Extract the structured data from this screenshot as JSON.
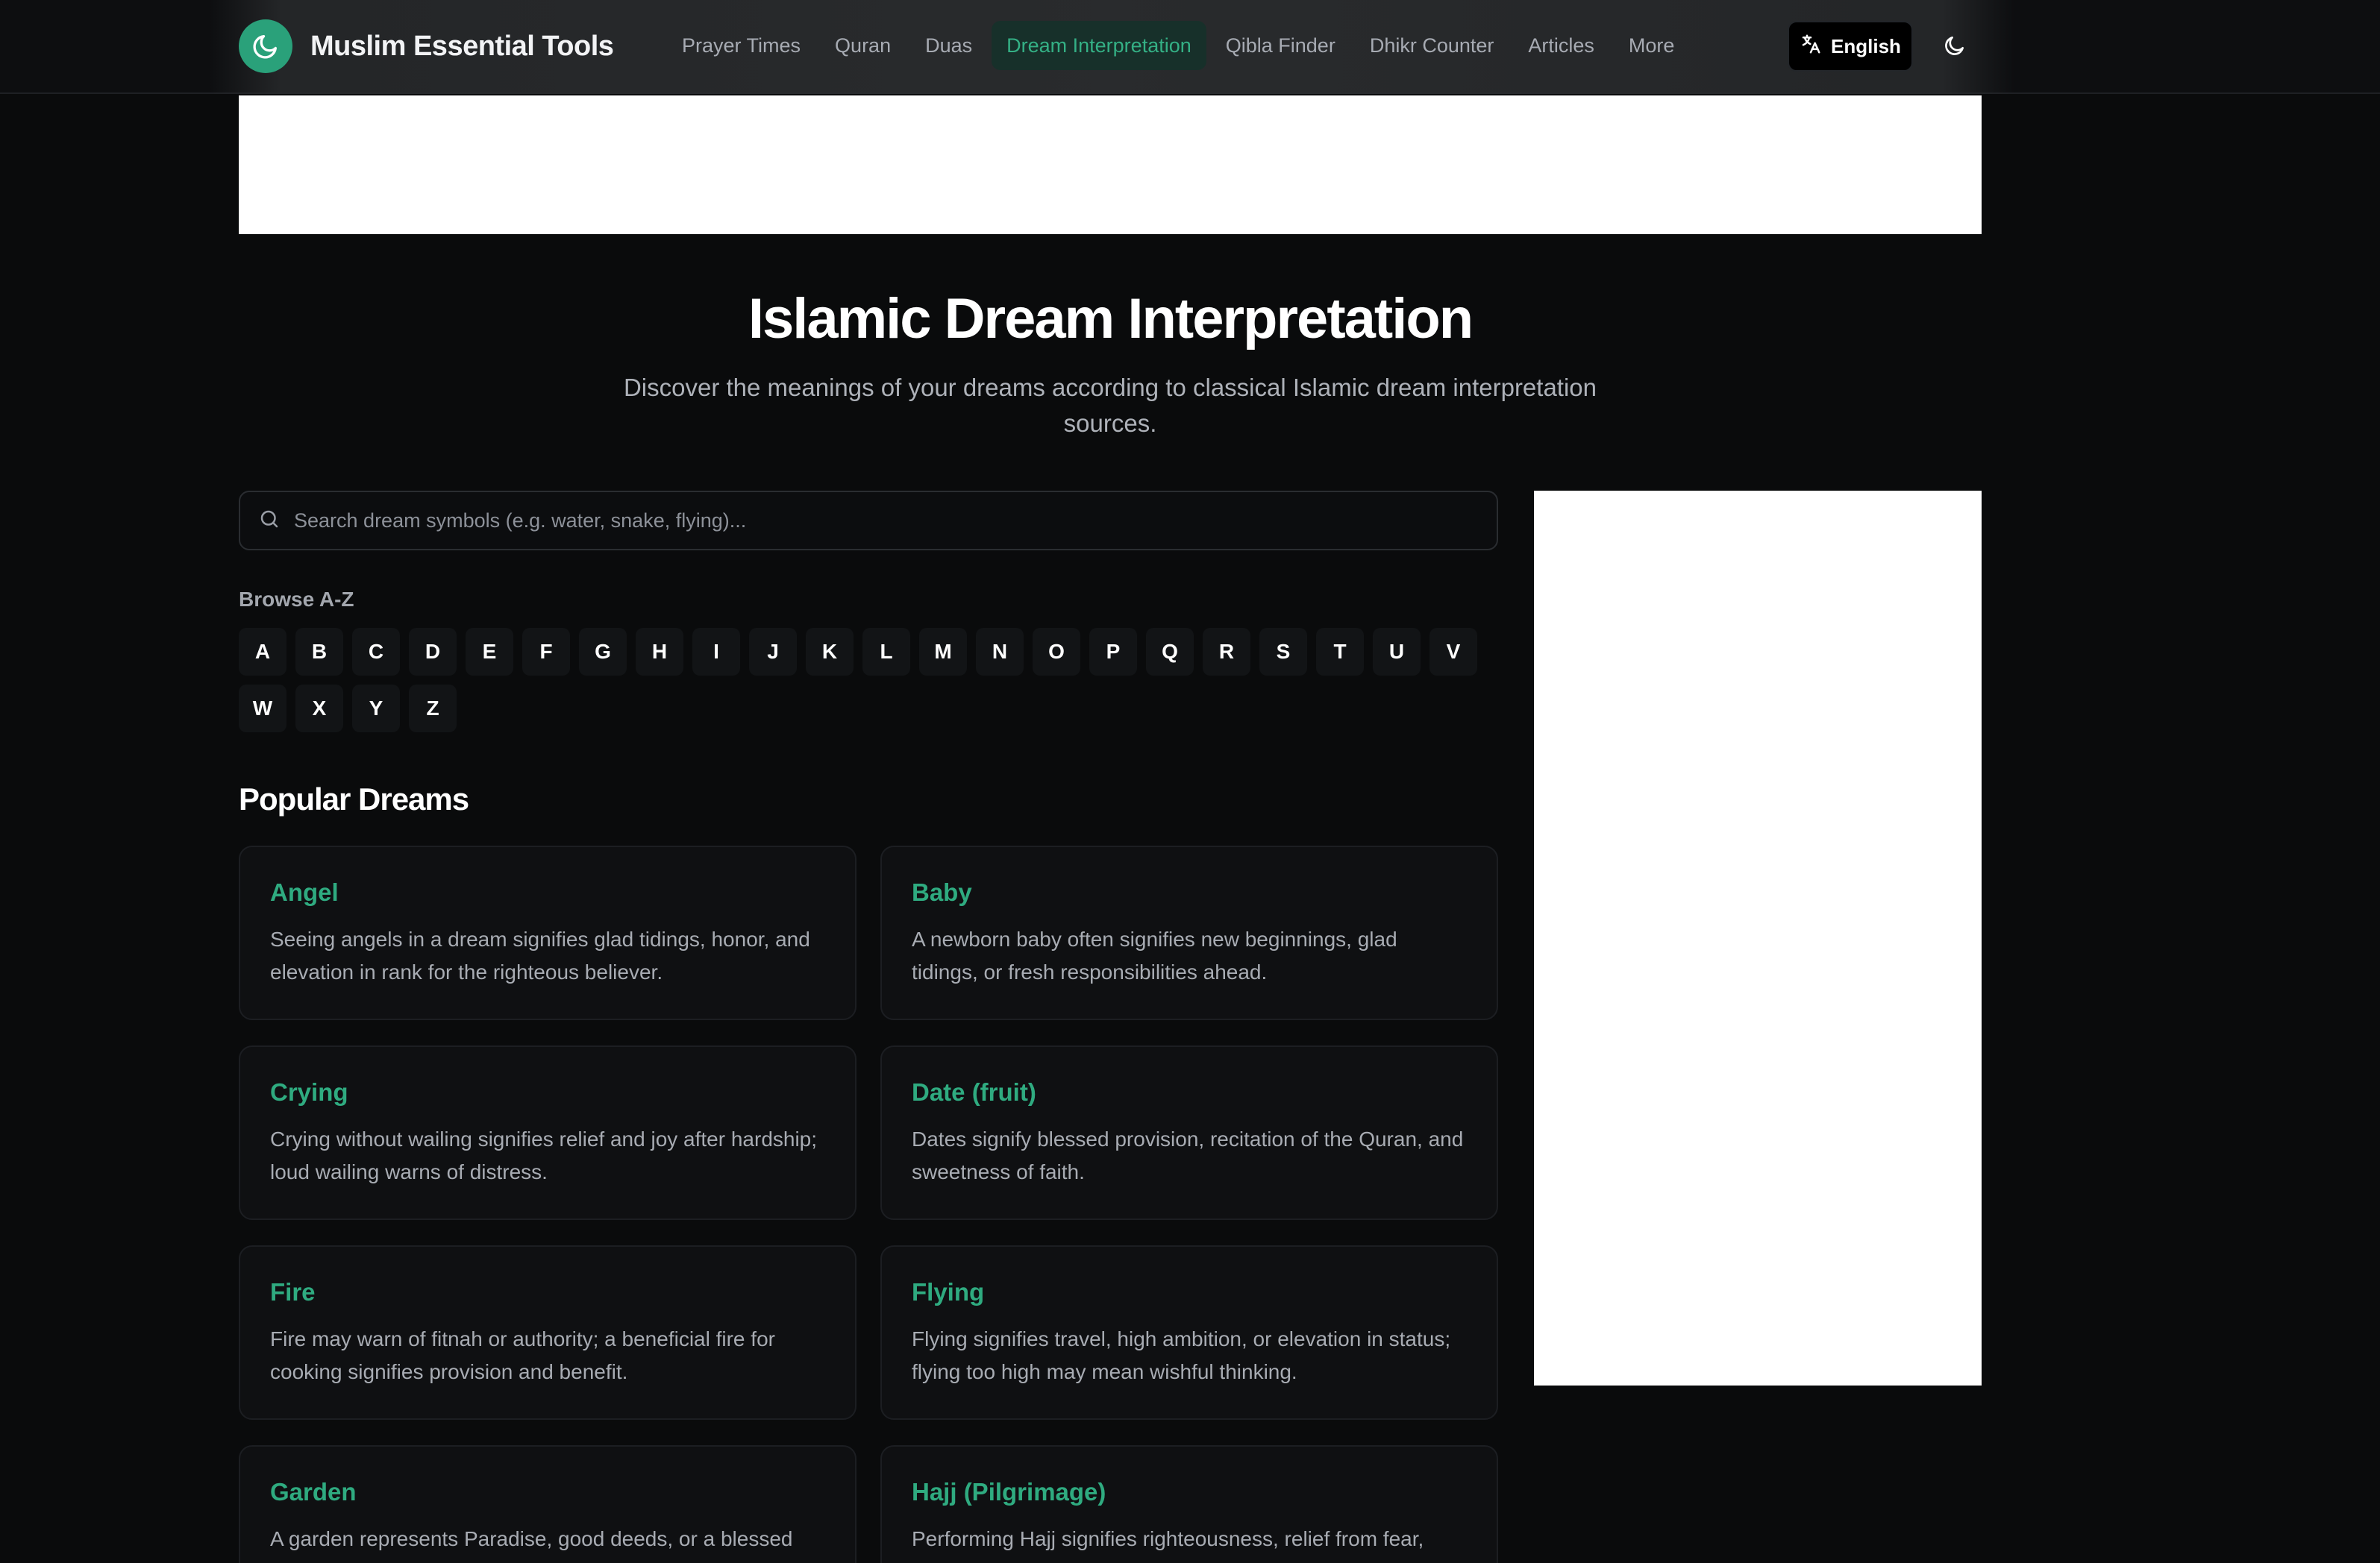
{
  "brand": {
    "name": "Muslim Essential Tools",
    "logo_icon": "crescent-moon-icon",
    "accent": "#2aa17a"
  },
  "nav": {
    "items": [
      {
        "label": "Prayer Times"
      },
      {
        "label": "Quran"
      },
      {
        "label": "Duas"
      },
      {
        "label": "Dream Interpretation"
      },
      {
        "label": "Qibla Finder"
      },
      {
        "label": "Dhikr Counter"
      },
      {
        "label": "Articles"
      },
      {
        "label": "More"
      }
    ],
    "active": "Dream Interpretation"
  },
  "language": {
    "label": "English",
    "icon": "translate-icon"
  },
  "theme_toggle": {
    "icon": "moon-icon"
  },
  "hero": {
    "title": "Islamic Dream Interpretation",
    "subtitle": "Discover the meanings of your dreams according to classical Islamic dream interpretation sources."
  },
  "search": {
    "placeholder": "Search dream symbols (e.g. water, snake, flying)...",
    "value": "",
    "icon": "search-icon"
  },
  "browse": {
    "label": "Browse A-Z",
    "letters": [
      "A",
      "B",
      "C",
      "D",
      "E",
      "F",
      "G",
      "H",
      "I",
      "J",
      "K",
      "L",
      "M",
      "N",
      "O",
      "P",
      "Q",
      "R",
      "S",
      "T",
      "U",
      "V",
      "W",
      "X",
      "Y",
      "Z"
    ]
  },
  "popular": {
    "title": "Popular Dreams",
    "items": [
      {
        "title": "Angel",
        "text": "Seeing angels in a dream signifies glad tidings, honor, and elevation in rank for the righteous believer."
      },
      {
        "title": "Baby",
        "text": "A newborn baby often signifies new beginnings, glad tidings, or fresh responsibilities ahead."
      },
      {
        "title": "Crying",
        "text": "Crying without wailing signifies relief and joy after hardship; loud wailing warns of distress."
      },
      {
        "title": "Date (fruit)",
        "text": "Dates signify blessed provision, recitation of the Quran, and sweetness of faith."
      },
      {
        "title": "Fire",
        "text": "Fire may warn of fitnah or authority; a beneficial fire for cooking signifies provision and benefit."
      },
      {
        "title": "Flying",
        "text": "Flying signifies travel, high ambition, or elevation in status; flying too high may mean wishful thinking."
      },
      {
        "title": "Garden",
        "text": "A garden represents Paradise, good deeds, or a blessed"
      },
      {
        "title": "Hajj (Pilgrimage)",
        "text": "Performing Hajj signifies righteousness, relief from fear,"
      }
    ]
  }
}
